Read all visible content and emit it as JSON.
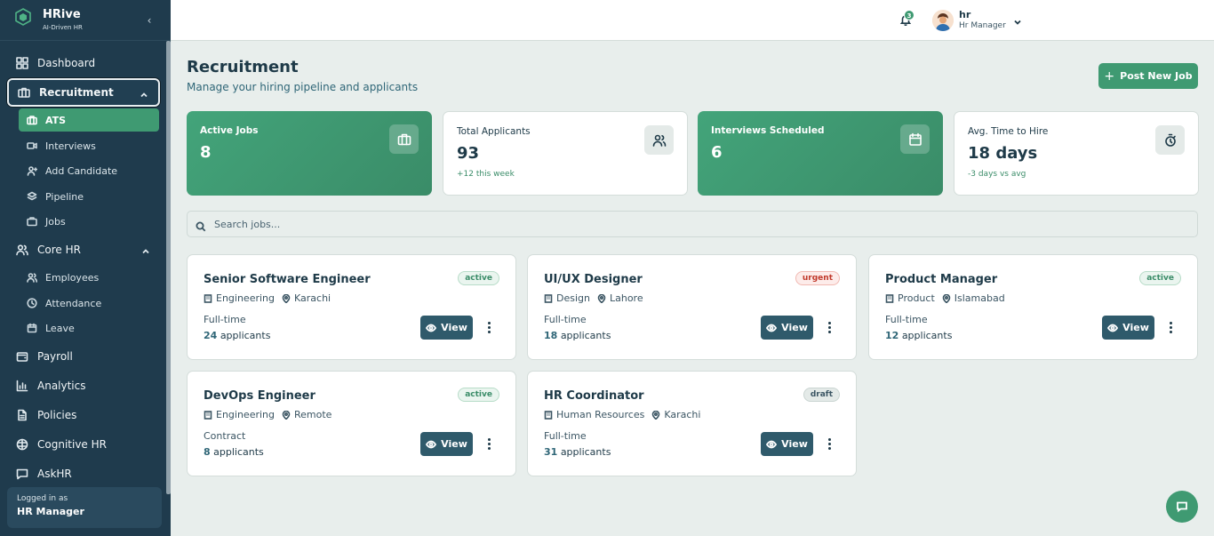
{
  "brand": {
    "name": "HRive",
    "tagline": "AI-Driven HR"
  },
  "sidebar": {
    "items": [
      {
        "label": "Dashboard",
        "icon": "dashboard-icon"
      },
      {
        "label": "Recruitment",
        "icon": "briefcase-icon",
        "expanded": true
      },
      {
        "label": "Core HR",
        "icon": "users-icon",
        "expanded": true
      },
      {
        "label": "Payroll",
        "icon": "wallet-icon"
      },
      {
        "label": "Analytics",
        "icon": "bar-chart-icon"
      },
      {
        "label": "Policies",
        "icon": "file-icon"
      },
      {
        "label": "Cognitive HR",
        "icon": "brain-icon"
      },
      {
        "label": "AskHR",
        "icon": "message-icon"
      }
    ],
    "recruitment_sub": [
      {
        "label": "ATS",
        "icon": "briefcase-icon",
        "active": true
      },
      {
        "label": "Interviews",
        "icon": "video-icon"
      },
      {
        "label": "Add Candidate",
        "icon": "user-plus-icon"
      },
      {
        "label": "Pipeline",
        "icon": "layers-icon"
      },
      {
        "label": "Jobs",
        "icon": "briefcase-icon"
      }
    ],
    "corehr_sub": [
      {
        "label": "Employees",
        "icon": "users-icon"
      },
      {
        "label": "Attendance",
        "icon": "clock-icon"
      },
      {
        "label": "Leave",
        "icon": "calendar-icon"
      }
    ],
    "logged_in": {
      "prefix": "Logged in as",
      "role": "HR Manager"
    }
  },
  "topbar": {
    "notification_count": "3",
    "user": {
      "name": "hr",
      "role": "Hr Manager"
    }
  },
  "page": {
    "title": "Recruitment",
    "subtitle": "Manage your hiring pipeline and applicants",
    "post_button": "Post New Job"
  },
  "stats": [
    {
      "label": "Active Jobs",
      "value": "8",
      "note": "",
      "icon": "briefcase-icon",
      "style": "green"
    },
    {
      "label": "Total Applicants",
      "value": "93",
      "note": "+12 this week",
      "icon": "users-icon",
      "style": "white"
    },
    {
      "label": "Interviews Scheduled",
      "value": "6",
      "note": "",
      "icon": "calendar-icon",
      "style": "green"
    },
    {
      "label": "Avg. Time to Hire",
      "value": "18 days",
      "note": "-3 days vs avg",
      "icon": "timer-icon",
      "style": "white"
    }
  ],
  "search": {
    "placeholder": "Search jobs..."
  },
  "jobs": [
    {
      "title": "Senior Software Engineer",
      "status": "active",
      "department": "Engineering",
      "location": "Karachi",
      "type": "Full-time",
      "applicants": "24",
      "applicants_suffix": "applicants",
      "view": "View"
    },
    {
      "title": "UI/UX Designer",
      "status": "urgent",
      "department": "Design",
      "location": "Lahore",
      "type": "Full-time",
      "applicants": "18",
      "applicants_suffix": "applicants",
      "view": "View"
    },
    {
      "title": "Product Manager",
      "status": "active",
      "department": "Product",
      "location": "Islamabad",
      "type": "Full-time",
      "applicants": "12",
      "applicants_suffix": "applicants",
      "view": "View"
    },
    {
      "title": "DevOps Engineer",
      "status": "active",
      "department": "Engineering",
      "location": "Remote",
      "type": "Contract",
      "applicants": "8",
      "applicants_suffix": "applicants",
      "view": "View"
    },
    {
      "title": "HR Coordinator",
      "status": "draft",
      "department": "Human Resources",
      "location": "Karachi",
      "type": "Full-time",
      "applicants": "31",
      "applicants_suffix": "applicants",
      "view": "View"
    }
  ],
  "colors": {
    "sidebar": "#1f3b4d",
    "accent": "#3f9a72",
    "button": "#2f5a6b",
    "background": "#e8eeec"
  }
}
